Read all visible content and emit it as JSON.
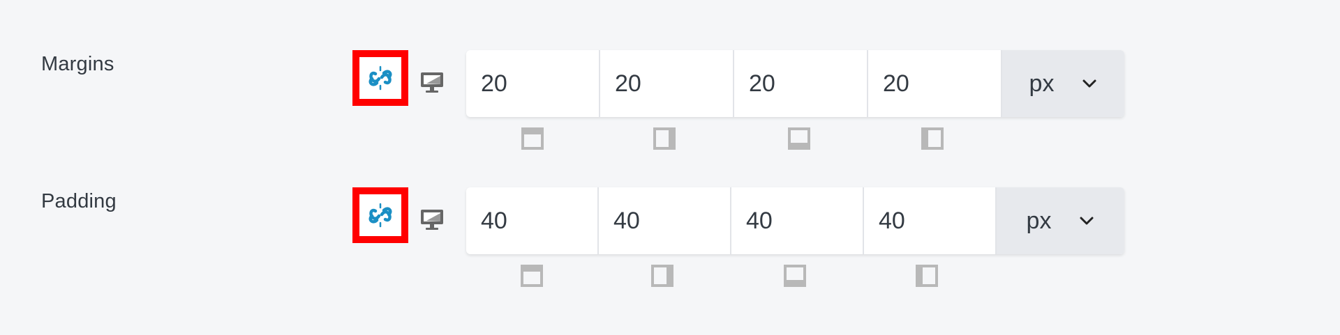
{
  "colors": {
    "page_bg": "#f5f6f8",
    "link_icon": "#1b8fc4",
    "highlight_border": "#ff0000",
    "unit_bg": "#e7e9ed",
    "icon_gray": "#b8b8b8"
  },
  "margins": {
    "label": "Margins",
    "link_icon": "link-icon",
    "device_icon": "desktop-icon",
    "top": "20",
    "right": "20",
    "bottom": "20",
    "left": "20",
    "unit": "px"
  },
  "padding": {
    "label": "Padding",
    "link_icon": "link-icon",
    "device_icon": "desktop-icon",
    "top": "40",
    "right": "40",
    "bottom": "40",
    "left": "40",
    "unit": "px"
  }
}
